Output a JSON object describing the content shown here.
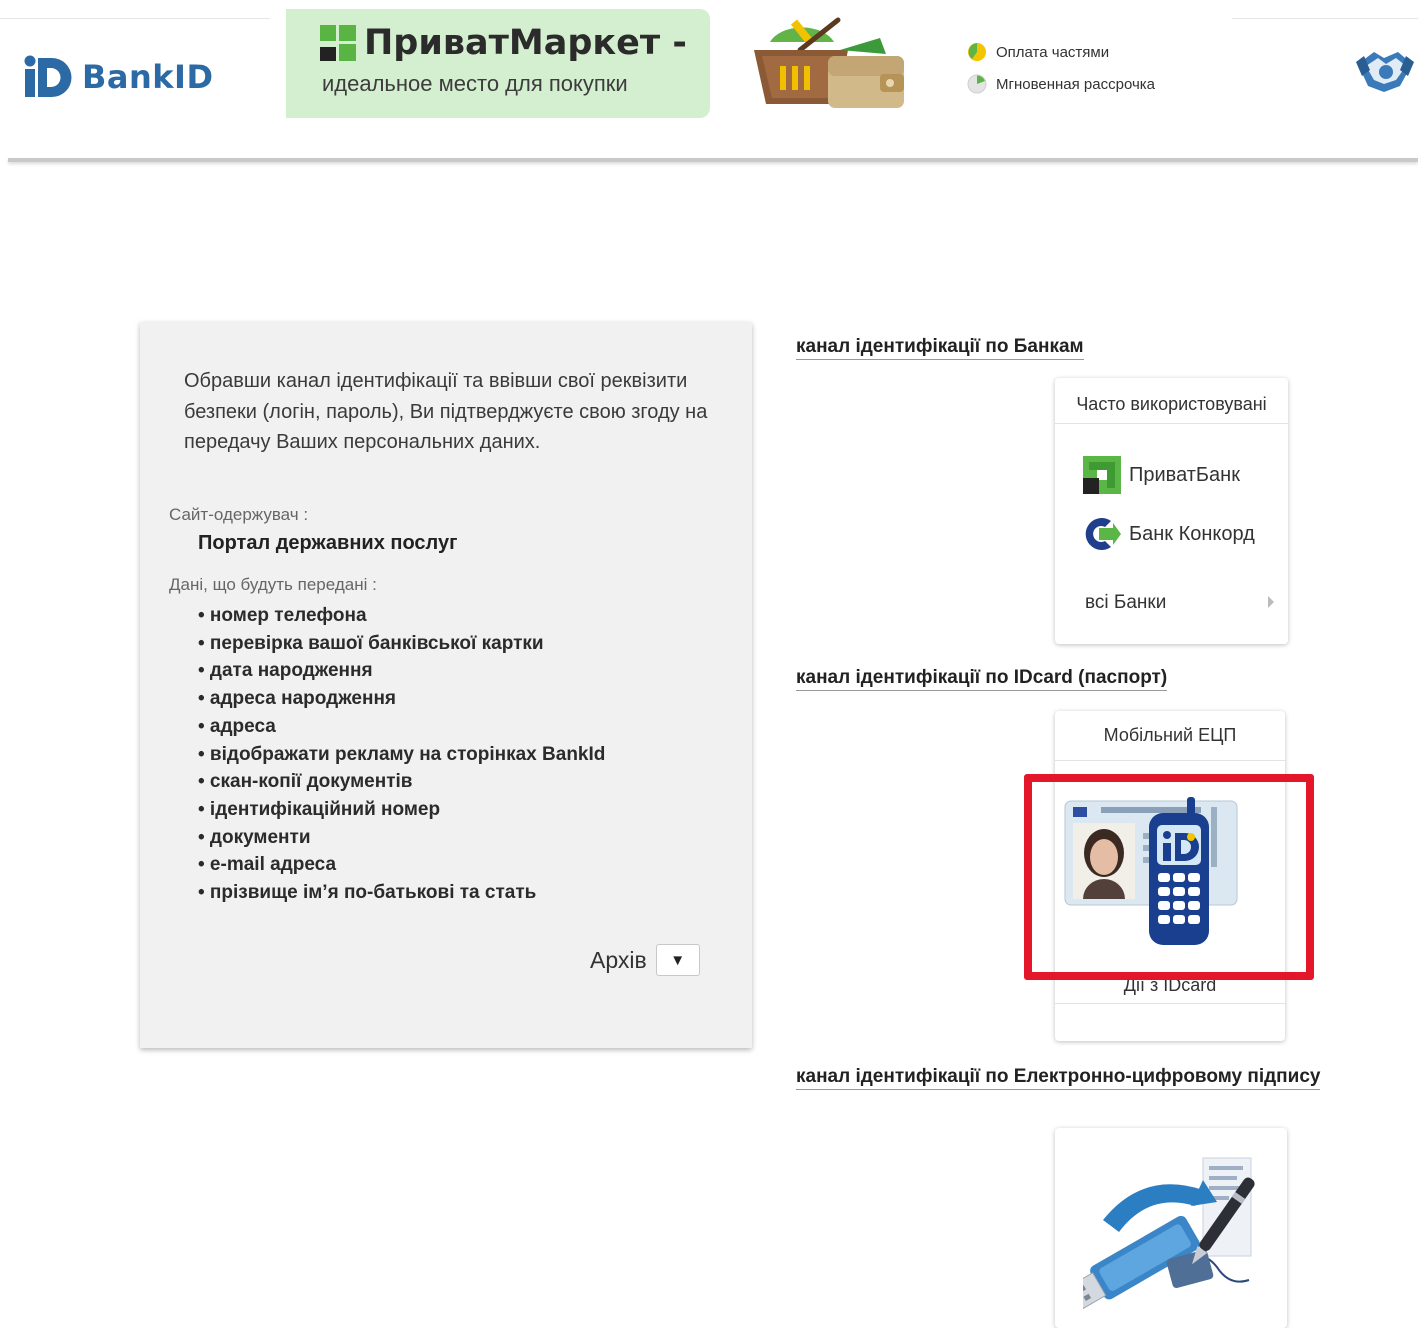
{
  "header": {
    "logo_text": "BankID",
    "banner_title": "ПриватМаркет -",
    "banner_subtitle": "идеальное место  для покупки",
    "promo_items": [
      "Оплата частями",
      "Мгновенная рассрочка"
    ]
  },
  "consent": {
    "intro": "Обравши канал ідентифікації та ввівши свої реквізити безпеки (логін, пароль), Ви підтверджуєте свою згоду на передачу Ваших персональних даних.",
    "site_label": "Сайт-одержувач :",
    "site_value": "Портал державних послуг",
    "data_label": "Дані, що будуть передані :",
    "data_items": [
      "номер телефона",
      "перевірка вашої банківської картки",
      "дата народження",
      "адреса народження",
      "адреса",
      "відображати рекламу на сторінках BankId",
      "скан-копії документів",
      "ідентифікаційний номер",
      "документи",
      "e-mail адреса",
      "прізвище ім’я по-батькові та стать"
    ],
    "archive_label": "Архів",
    "archive_toggle": "▼"
  },
  "channels": {
    "banks": {
      "title": "канал ідентифікації по Банкам",
      "card_header": "Часто використовувані",
      "items": [
        "ПриватБанк",
        "Банк Конкорд"
      ],
      "all_banks": "всі Банки"
    },
    "idcard": {
      "title": "канал ідентифікації по IDcard (паспорт)",
      "card_header": "Мобільний ЕЦП",
      "card_footer": "Дії з IDcard"
    },
    "eds": {
      "title": "канал ідентифікації по Електронно-цифровому підпису"
    }
  },
  "colors": {
    "highlight_frame": "#e3162a",
    "brand_blue": "#2c6aa6",
    "banner_green": "#d4efcf",
    "privat_green": "#5ab645"
  }
}
